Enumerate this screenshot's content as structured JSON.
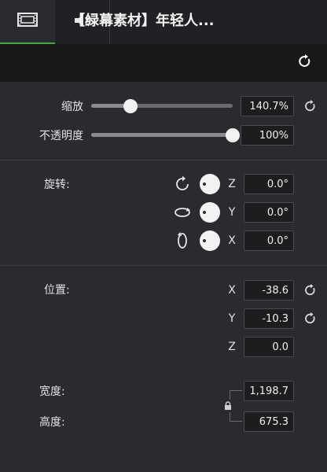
{
  "tabs": [
    {
      "name": "video-tab",
      "icon": "film-icon",
      "active": true
    },
    {
      "name": "audio-tab",
      "icon": "speaker-icon",
      "active": false
    }
  ],
  "header": {
    "title": "【绿幕素材】年轻人..."
  },
  "scale": {
    "label": "缩放",
    "value": "140.7%",
    "level": 0.28
  },
  "opacity": {
    "label": "不透明度",
    "value": "100%",
    "level": 1.0
  },
  "rotation": {
    "label": "旋转:",
    "rows": [
      {
        "axis": "Z",
        "value": "0.0°"
      },
      {
        "axis": "Y",
        "value": "0.0°"
      },
      {
        "axis": "X",
        "value": "0.0°"
      }
    ]
  },
  "position": {
    "label": "位置:",
    "rows": [
      {
        "axis": "X",
        "value": "-38.6"
      },
      {
        "axis": "Y",
        "value": "-10.3"
      },
      {
        "axis": "Z",
        "value": "0.0"
      }
    ]
  },
  "size": {
    "width_label": "宽度:",
    "width_value": "1,198.7",
    "height_label": "高度:",
    "height_value": "675.3"
  },
  "colors": {
    "accent": "#4aa544",
    "panel": "#2a2b2e",
    "header": "#17181a"
  }
}
